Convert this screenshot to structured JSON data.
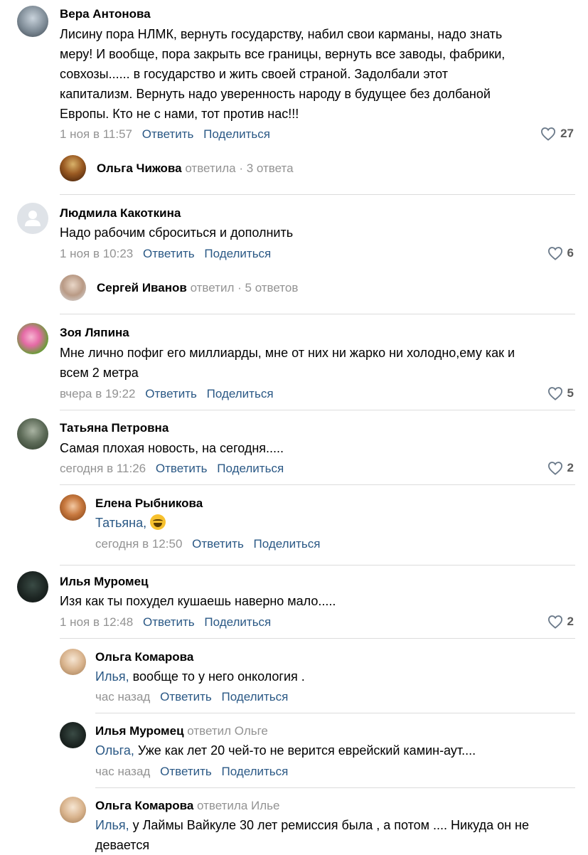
{
  "comments": [
    {
      "author": "Вера Антонова",
      "lines": [
        "Лисину пора НЛМК, вернуть государству, набил свои карманы, надо знать",
        "меру! И вообще, пора закрыть все границы, вернуть все заводы, фабрики,",
        "совхозы...... в государство и жить своей страной. Задолбали этот",
        "капитализм. Вернуть надо уверенность народу в будущее без долбаной",
        "Европы. Кто не с нами, тот против нас!!!"
      ],
      "time": "1 ноя в 11:57",
      "reply_label": "Ответить",
      "share_label": "Поделиться",
      "likes": "27",
      "thread": {
        "name": "Ольга Чижова",
        "action": "ответила",
        "count": "3 ответа"
      }
    },
    {
      "author": "Людмила Какоткина",
      "lines": [
        "Надо рабочим сброситься и дополнить"
      ],
      "time": "1 ноя в 10:23",
      "reply_label": "Ответить",
      "share_label": "Поделиться",
      "likes": "6",
      "thread": {
        "name": "Сергей Иванов",
        "action": "ответил",
        "count": "5 ответов"
      }
    },
    {
      "author": "Зоя Ляпина",
      "lines": [
        "Мне лично пофиг его миллиарды, мне от них ни жарко ни холодно,ему как и",
        "всем 2 метра"
      ],
      "time": "вчера в 19:22",
      "reply_label": "Ответить",
      "share_label": "Поделиться",
      "likes": "5"
    },
    {
      "author": "Татьяна Петровна",
      "lines": [
        "Самая плохая новость, на сегодня....."
      ],
      "time": "сегодня в 11:26",
      "reply_label": "Ответить",
      "share_label": "Поделиться",
      "likes": "2",
      "replies": [
        {
          "author": "Елена Рыбникова",
          "mention": "Татьяна,",
          "text": "",
          "time": "сегодня в 12:50",
          "reply_label": "Ответить",
          "share_label": "Поделиться",
          "emoji": "face-with-tears-of-joy-icon"
        }
      ]
    },
    {
      "author": "Илья Муромец",
      "lines": [
        "Изя как ты похудел кушаешь наверно мало....."
      ],
      "time": "1 ноя в 12:48",
      "reply_label": "Ответить",
      "share_label": "Поделиться",
      "likes": "2",
      "replies": [
        {
          "author": "Ольга Комарова",
          "mention": "Илья,",
          "text": " вообще то у него онкология .",
          "time": "час назад",
          "reply_label": "Ответить",
          "share_label": "Поделиться"
        },
        {
          "author": "Илья Муромец",
          "replyto": "ответил Ольге",
          "mention": "Ольга,",
          "text": " Уже как лет 20 чей-то не верится еврейский камин-аут....",
          "time": "час назад",
          "reply_label": "Ответить",
          "share_label": "Поделиться"
        },
        {
          "author": "Ольга Комарова",
          "replyto": "ответила Илье",
          "mention": "Илья,",
          "text": " у Лаймы Вайкуле 30 лет ремиссия была , а потом .... Никуда он не",
          "text2": "девается"
        }
      ]
    }
  ],
  "colors": {
    "link": "#2a5885",
    "muted": "#939393",
    "separator": "#dcdcdc"
  }
}
